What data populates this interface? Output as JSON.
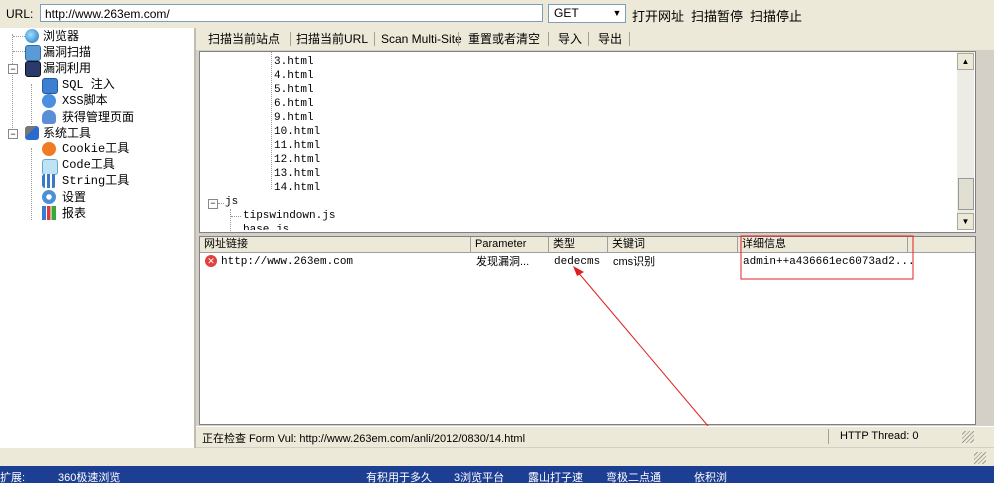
{
  "urlbar": {
    "label": "URL:",
    "value": "http://www.263em.com/",
    "method": "GET",
    "buttons": [
      "打开网址",
      "扫描暂停",
      "扫描停止"
    ]
  },
  "tree": {
    "items": [
      {
        "label": "浏览器",
        "icon": "globe-icon"
      },
      {
        "label": "漏洞扫描",
        "icon": "scan-icon"
      },
      {
        "label": "漏洞利用",
        "icon": "exploit-icon"
      },
      {
        "label": "SQL 注入",
        "icon": "database-icon"
      },
      {
        "label": "XSS脚本",
        "icon": "xss-icon"
      },
      {
        "label": "获得管理页面",
        "icon": "admin-user-icon"
      },
      {
        "label": "系统工具",
        "icon": "tools-icon"
      },
      {
        "label": "Cookie工具",
        "icon": "cookie-icon"
      },
      {
        "label": "Code工具",
        "icon": "code-icon"
      },
      {
        "label": "String工具",
        "icon": "string-icon"
      },
      {
        "label": "设置",
        "icon": "settings-gear-icon"
      },
      {
        "label": "报表",
        "icon": "report-chart-icon"
      }
    ]
  },
  "toolbar": {
    "buttons": [
      "扫描当前站点",
      "扫描当前URL",
      "Scan Multi-Site",
      "重置或者清空",
      "导入",
      "导出"
    ]
  },
  "files": {
    "items": [
      "3.html",
      "4.html",
      "5.html",
      "6.html",
      "9.html",
      "10.html",
      "11.html",
      "12.html",
      "13.html",
      "14.html"
    ],
    "folder": "js",
    "subitems": [
      "tipswindown.js",
      "base.js"
    ]
  },
  "grid": {
    "headers": [
      "网址链接",
      "Parameter",
      "类型",
      "关键词",
      "详细信息"
    ],
    "row": {
      "url": "http://www.263em.com",
      "parameter": "发现漏洞...",
      "type": "dedecms",
      "keyword": "cms识别",
      "detail": "admin++a436661ec6073ad2..."
    }
  },
  "status": {
    "checking": "正在检查 Form Vul: http://www.263em.com/anli/2012/0830/14.html",
    "thread": "HTTP Thread: 0"
  },
  "taskbar": {
    "items": [
      "扩展:",
      "360极速浏览",
      "有积用于多久",
      "3浏览平台",
      "露山打子速",
      "弯极二点通",
      "依积浏"
    ]
  },
  "colors": {
    "annotation_red": "#e02020",
    "window_bg": "#ece9d8",
    "taskbar": "#1d3f93"
  }
}
